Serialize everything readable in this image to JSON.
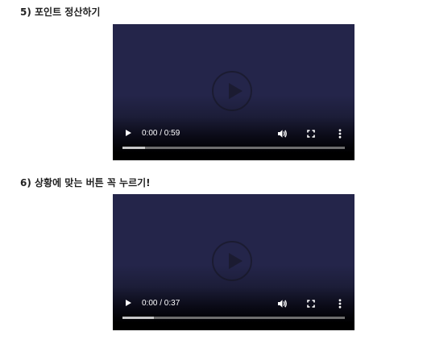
{
  "sections": [
    {
      "title": "5) 포인트 정산하기",
      "player": {
        "time_display": "0:00 / 0:59",
        "buffered_fraction": 0.1
      }
    },
    {
      "title": "6) 상황에 맞는 버튼 꼭 누르기!",
      "player": {
        "time_display": "0:00 / 0:37",
        "buffered_fraction": 0.14
      }
    }
  ],
  "icons": {
    "overlay": "play-circle-icon",
    "play": "play-icon",
    "volume": "volume-icon",
    "fullscreen": "fullscreen-icon",
    "menu": "more-vertical-icon"
  },
  "colors": {
    "video_background": "#24254a",
    "control_icon": "#ffffff",
    "title_text": "#222222"
  }
}
